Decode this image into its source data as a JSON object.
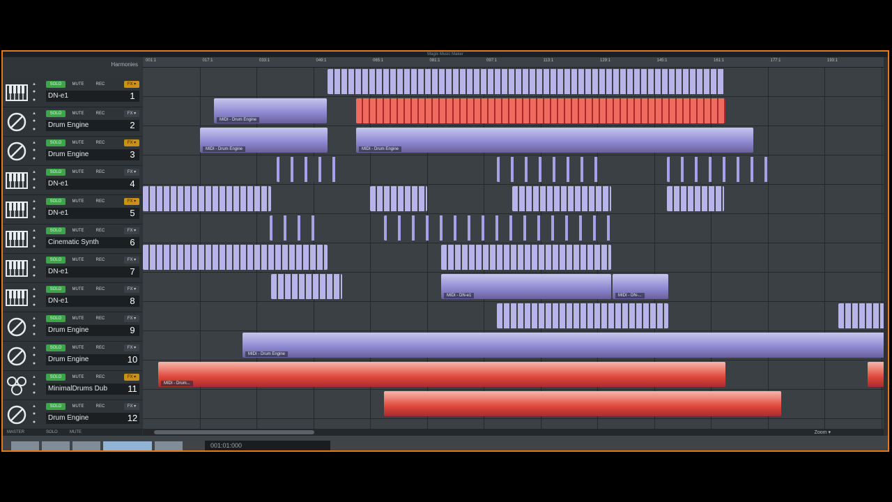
{
  "window": {
    "title": "Magix Music Maker"
  },
  "header": {
    "preset_label": "Harmonies"
  },
  "ruler": {
    "ticks": [
      "001:1",
      "017:1",
      "033:1",
      "049:1",
      "065:1",
      "081:1",
      "097:1",
      "113:1",
      "129:1",
      "145:1",
      "161:1",
      "177:1",
      "193:1"
    ]
  },
  "buttons": {
    "solo": "SOLO",
    "mute": "MUTE",
    "rec": "REC",
    "fx": "FX ▾"
  },
  "tracks": [
    {
      "name": "DN-e1",
      "num": "1",
      "icon": "keyboard-icon",
      "fx_gold": true
    },
    {
      "name": "Drum Engine",
      "num": "2",
      "icon": "drum-icon",
      "fx_gold": false
    },
    {
      "name": "Drum Engine",
      "num": "3",
      "icon": "drum-icon",
      "fx_gold": true
    },
    {
      "name": "DN-e1",
      "num": "4",
      "icon": "keyboard-icon",
      "fx_gold": false
    },
    {
      "name": "DN-e1",
      "num": "5",
      "icon": "keyboard-icon",
      "fx_gold": true
    },
    {
      "name": "Cinematic Synth",
      "num": "6",
      "icon": "keyboard-icon",
      "fx_gold": false
    },
    {
      "name": "DN-e1",
      "num": "7",
      "icon": "keyboard-icon",
      "fx_gold": false
    },
    {
      "name": "DN-e1",
      "num": "8",
      "icon": "keyboard-icon",
      "fx_gold": false
    },
    {
      "name": "Drum Engine",
      "num": "9",
      "icon": "drum-icon",
      "fx_gold": false
    },
    {
      "name": "Drum Engine",
      "num": "10",
      "icon": "drum-icon",
      "fx_gold": false
    },
    {
      "name": "MinimalDrums Dub",
      "num": "11",
      "icon": "drumkit-icon",
      "fx_gold": true
    },
    {
      "name": "Drum Engine",
      "num": "12",
      "icon": "drum-icon",
      "fx_gold": false
    }
  ],
  "clip_labels": {
    "midi_drum": "MIDI - Drum Engine",
    "midi_dn": "MIDI - DN-e1",
    "midi_dn_short": "MIDI - DN-...",
    "midi_drum_short": "MIDI - Drum..."
  },
  "footer": {
    "left1": "MASTER",
    "left2": "SOLO",
    "left3": "MUTE",
    "zoom": "Zoom ▾"
  },
  "transport": {
    "time": "001:01:000"
  },
  "colors": {
    "frame": "#e37a1f",
    "solo_green": "#3fa34c",
    "fx_gold": "#c89219",
    "clip_purple": "#8b86cf",
    "clip_red": "#e0483c"
  }
}
